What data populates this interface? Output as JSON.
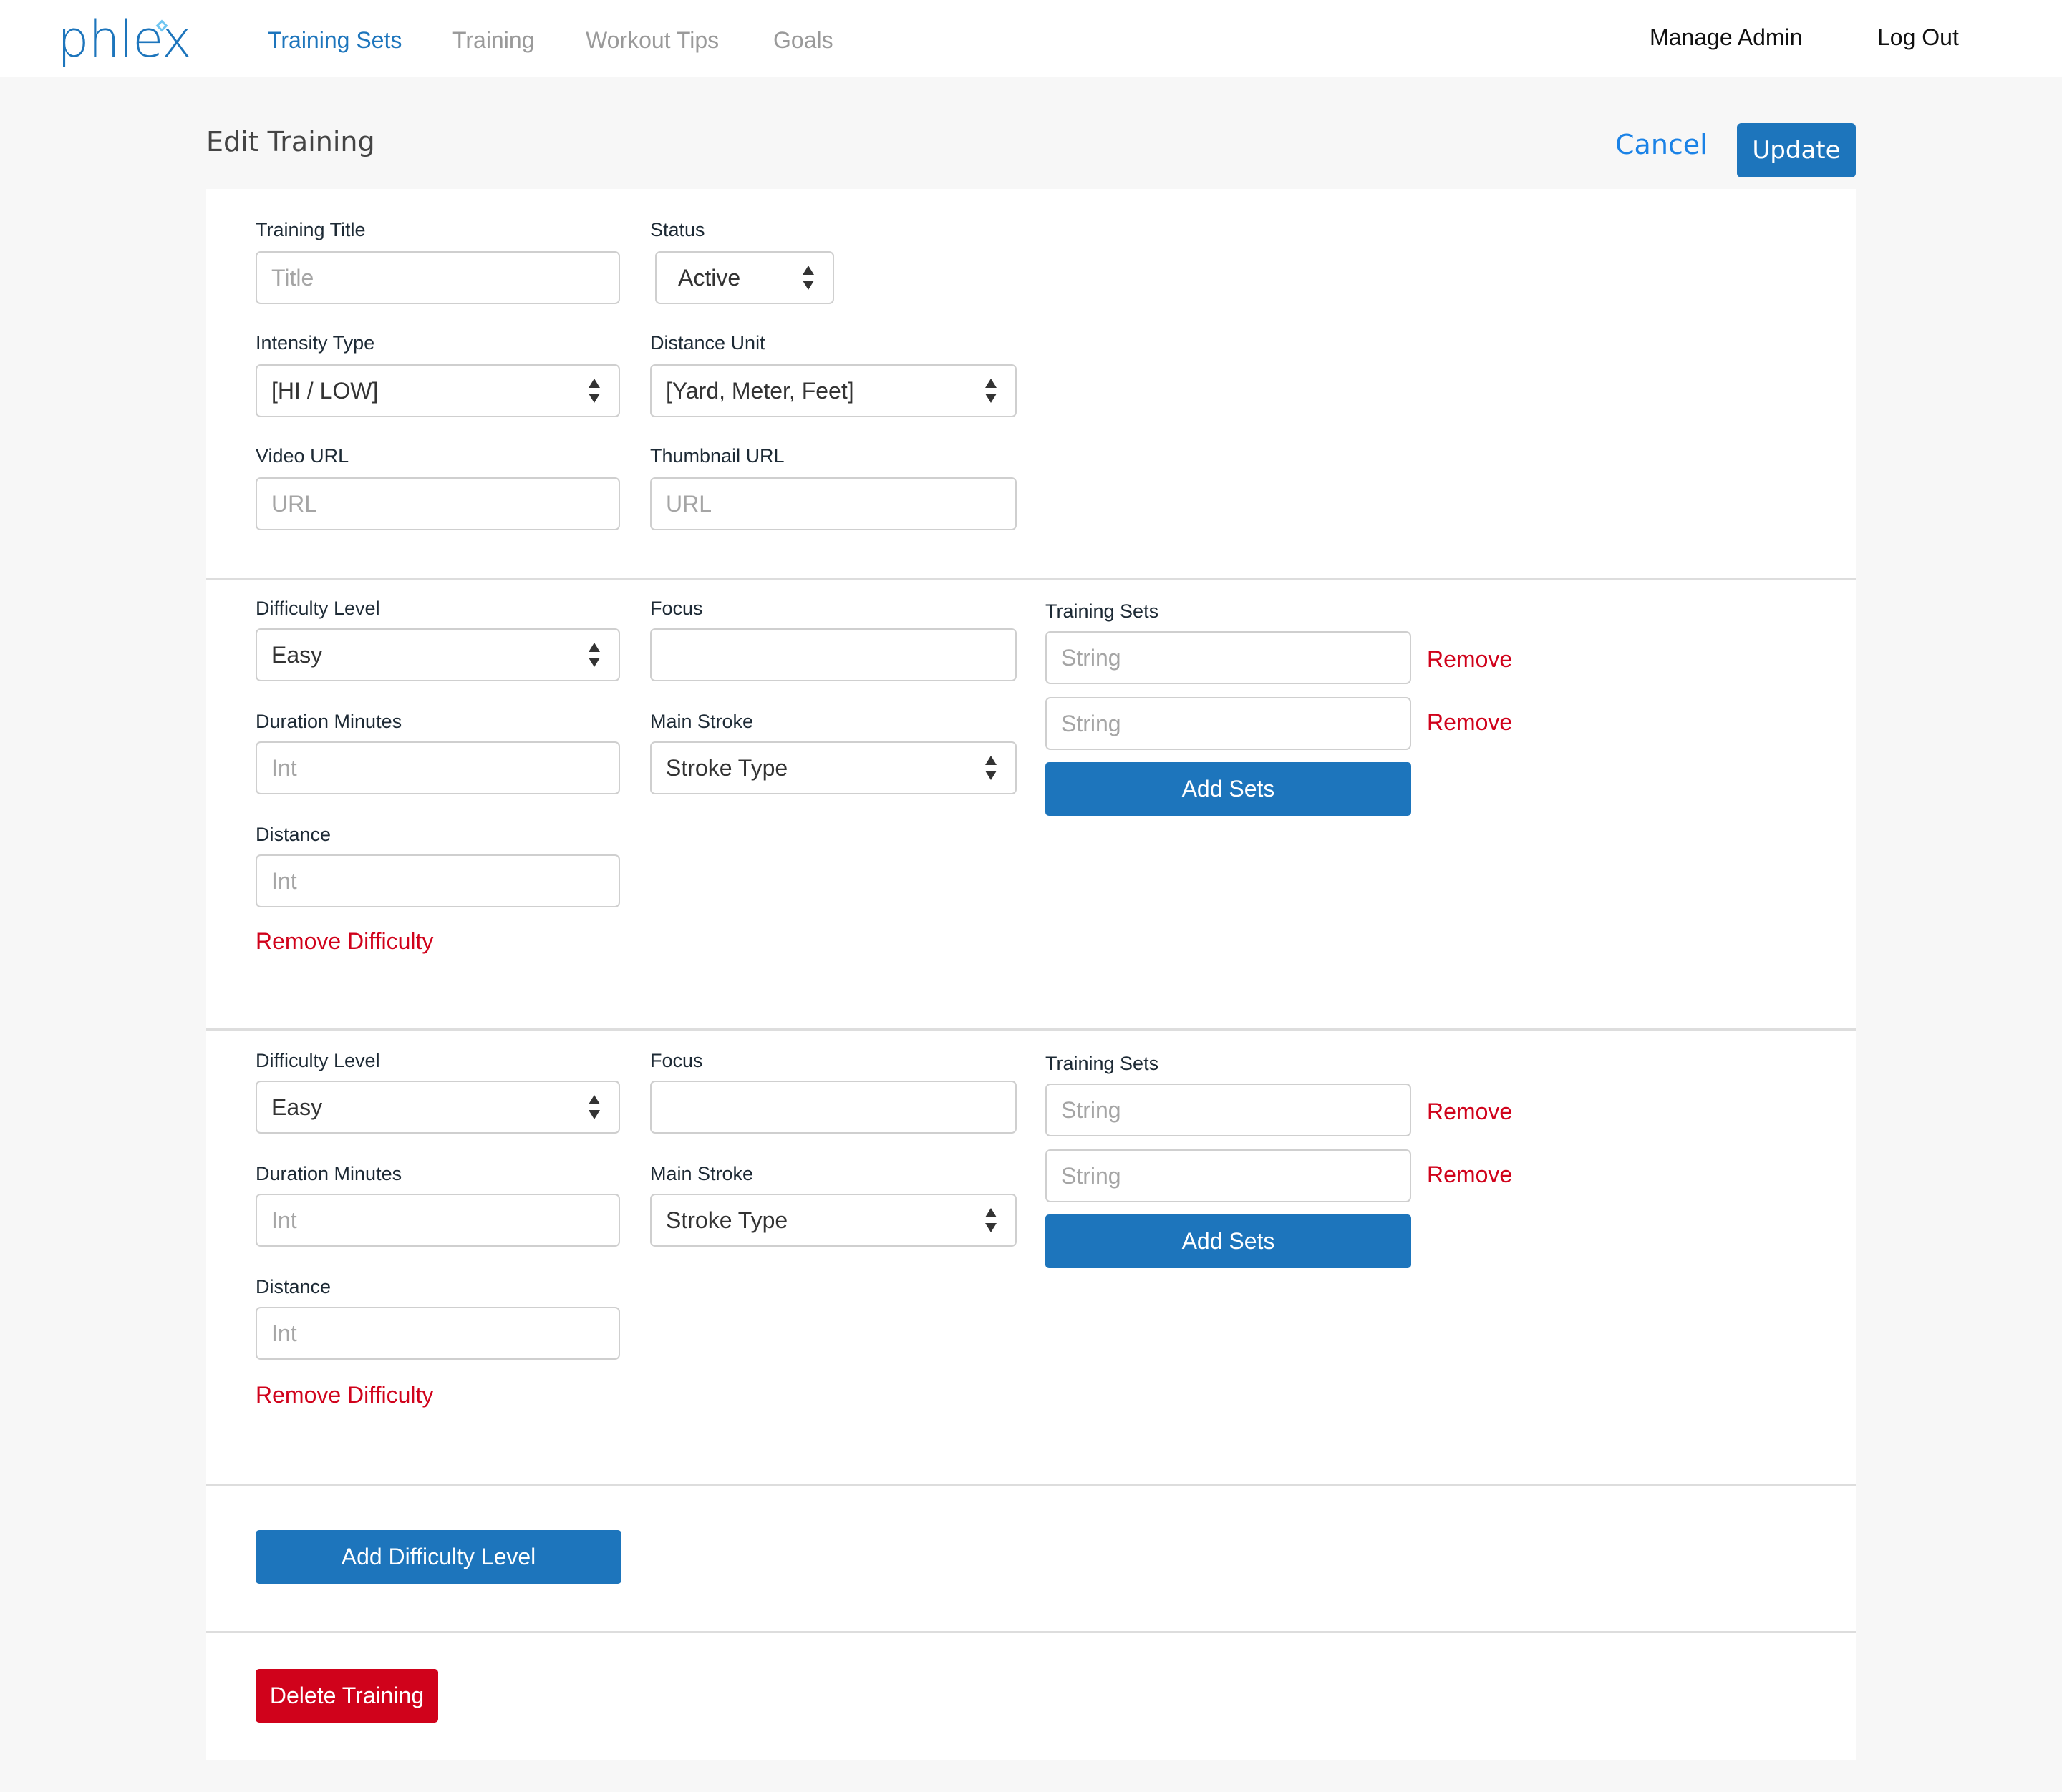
{
  "header": {
    "logo": "phlex",
    "nav": [
      {
        "label": "Training Sets",
        "active": true
      },
      {
        "label": "Training",
        "active": false
      },
      {
        "label": "Workout Tips",
        "active": false
      },
      {
        "label": "Goals",
        "active": false
      }
    ],
    "manage_admin": "Manage Admin",
    "log_out": "Log Out"
  },
  "page": {
    "title": "Edit Training",
    "cancel_label": "Cancel",
    "update_label": "Update"
  },
  "general": {
    "training_title": {
      "label": "Training Title",
      "placeholder": "Title",
      "value": ""
    },
    "status": {
      "label": "Status",
      "value": "Active"
    },
    "intensity_type": {
      "label": "Intensity Type",
      "value": "[HI / LOW]"
    },
    "distance_unit": {
      "label": "Distance Unit",
      "value": "[Yard, Meter, Feet]"
    },
    "video_url": {
      "label": "Video URL",
      "placeholder": "URL",
      "value": ""
    },
    "thumbnail_url": {
      "label": "Thumbnail URL",
      "placeholder": "URL",
      "value": ""
    }
  },
  "difficulties": [
    {
      "difficulty_level": {
        "label": "Difficulty Level",
        "value": "Easy"
      },
      "focus": {
        "label": "Focus",
        "value": ""
      },
      "duration_minutes": {
        "label": "Duration Minutes",
        "placeholder": "Int",
        "value": ""
      },
      "main_stroke": {
        "label": "Main Stroke",
        "value": "Stroke Type"
      },
      "distance": {
        "label": "Distance",
        "placeholder": "Int",
        "value": ""
      },
      "training_sets": {
        "label": "Training Sets",
        "items": [
          {
            "placeholder": "String",
            "value": "",
            "remove_label": "Remove"
          },
          {
            "placeholder": "String",
            "value": "",
            "remove_label": "Remove"
          }
        ],
        "add_label": "Add Sets"
      },
      "remove_label": "Remove Difficulty"
    },
    {
      "difficulty_level": {
        "label": "Difficulty Level",
        "value": "Easy"
      },
      "focus": {
        "label": "Focus",
        "value": ""
      },
      "duration_minutes": {
        "label": "Duration Minutes",
        "placeholder": "Int",
        "value": ""
      },
      "main_stroke": {
        "label": "Main Stroke",
        "value": "Stroke Type"
      },
      "distance": {
        "label": "Distance",
        "placeholder": "Int",
        "value": ""
      },
      "training_sets": {
        "label": "Training Sets",
        "items": [
          {
            "placeholder": "String",
            "value": "",
            "remove_label": "Remove"
          },
          {
            "placeholder": "String",
            "value": "",
            "remove_label": "Remove"
          }
        ],
        "add_label": "Add Sets"
      },
      "remove_label": "Remove Difficulty"
    }
  ],
  "actions": {
    "add_difficulty_label": "Add Difficulty Level",
    "delete_training_label": "Delete Training"
  },
  "colors": {
    "brand_blue": "#1d75bc",
    "link_blue": "#1a82e6",
    "danger_red": "#d0021b",
    "nav_inactive": "#9a9a9a"
  }
}
